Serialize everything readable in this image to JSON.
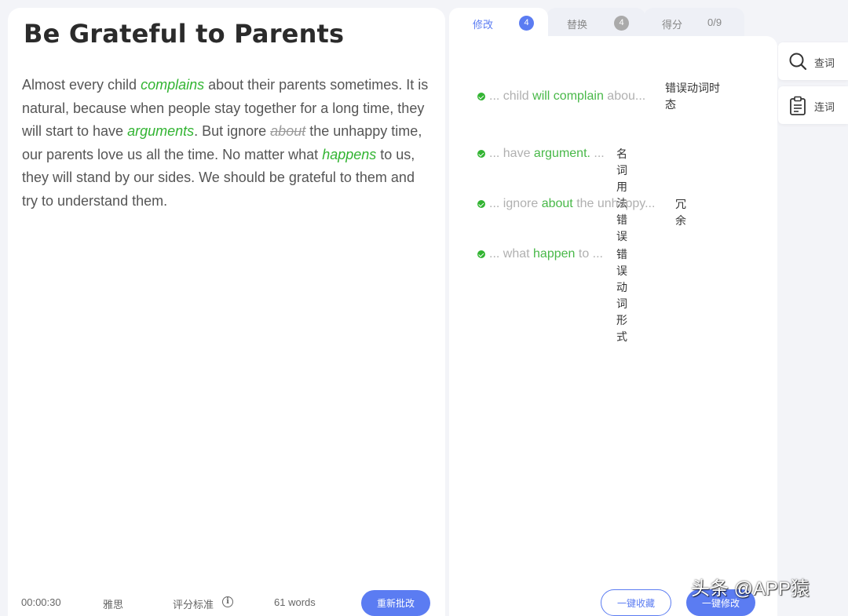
{
  "essay": {
    "title": "Be Grateful to Parents",
    "segments": [
      {
        "text": "Almost every child ",
        "style": "normal"
      },
      {
        "text": "complains",
        "style": "correction"
      },
      {
        "text": " about their parents sometimes. It is natural, because when people stay together for a long time, they will start to have ",
        "style": "normal"
      },
      {
        "text": "arguments",
        "style": "correction"
      },
      {
        "text": ". But ignore ",
        "style": "normal"
      },
      {
        "text": "about",
        "style": "deleted"
      },
      {
        "text": " the unhappy time, our parents love us all the time. No matter what ",
        "style": "normal"
      },
      {
        "text": "happens",
        "style": "correction"
      },
      {
        "text": " to us, they will stand by our sides. We should be grateful to them and try to understand them.",
        "style": "normal"
      }
    ],
    "footer": {
      "time": "00:00:30",
      "exam_type": "雅思",
      "scoring_standard": "评分标准",
      "info_symbol": "i",
      "word_count": "61 words",
      "regrade_label": "重新批改"
    }
  },
  "tabs": [
    {
      "label": "修改",
      "count": "4",
      "active": true
    },
    {
      "label": "替换",
      "count": "4",
      "active": false
    },
    {
      "label": "得分",
      "score": "0/9",
      "active": false
    }
  ],
  "errors": [
    {
      "before": "... child ",
      "highlight": "will complain",
      "after": " abou...",
      "type": "错误动词时态"
    },
    {
      "before": "... have ",
      "highlight": "argument.",
      "after": " ...",
      "type": "名词用法错误"
    },
    {
      "before": "... ignore ",
      "highlight": "about",
      "after": " the unhappy...",
      "type": "冗余"
    },
    {
      "before": "... what ",
      "highlight": "happen",
      "after": " to ...",
      "type": "错误动词形式"
    }
  ],
  "actions": {
    "collect_all": "一键收藏",
    "fix_all": "一键修改"
  },
  "tools": [
    {
      "label": "查词",
      "icon": "search-icon"
    },
    {
      "label": "连词",
      "icon": "clipboard-icon"
    }
  ],
  "watermark": "头条 @APP猿",
  "colors": {
    "accent": "#5b7cf2",
    "correction": "#32b432",
    "background": "#f3f4f8"
  }
}
